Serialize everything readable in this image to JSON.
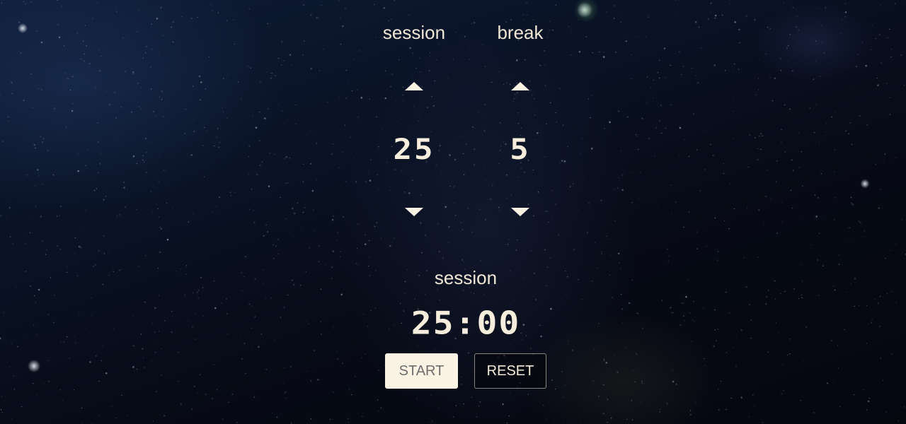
{
  "settings": {
    "session": {
      "label": "session",
      "value": "25"
    },
    "break": {
      "label": "break",
      "value": "5"
    }
  },
  "timer": {
    "mode_label": "session",
    "display": "25:00"
  },
  "buttons": {
    "start_label": "START",
    "reset_label": "RESET"
  },
  "icons": {
    "increment": "triangle-up-icon",
    "decrement": "triangle-down-icon"
  },
  "colors": {
    "text": "#f3ead9",
    "start_button_bg": "#fbf3e4",
    "start_button_text": "#6e6e6e",
    "background": "#070b17"
  }
}
